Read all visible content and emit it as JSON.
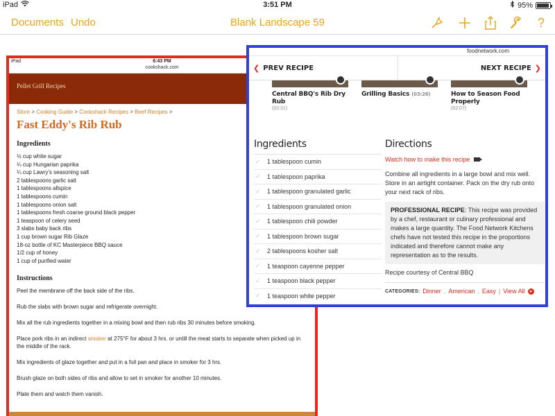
{
  "status_bar": {
    "device": "iPad",
    "time": "3:51 PM",
    "battery_percent_text": "95%",
    "battery_level": 0.95
  },
  "toolbar": {
    "documents_label": "Documents",
    "undo_label": "Undo",
    "title": "Blank Landscape 59",
    "icons": [
      "format-brush-icon",
      "plus-icon",
      "share-icon",
      "wrench-icon",
      "help-icon"
    ],
    "help_glyph": "?",
    "accent_color": "#e8a31a"
  },
  "left_screenshot": {
    "status": {
      "device": "iPad",
      "time": "6:43 PM"
    },
    "url": "cookshack.com",
    "header_title": "Pellet Grill Recipes",
    "breadcrumb": [
      "Store",
      "Cooking Guide",
      "Cookshack Recipes",
      "Beef Recipes"
    ],
    "title": "Fast Eddy's Rib Rub",
    "ingredients_heading": "Ingredients",
    "ingredients": [
      "½ cup white sugar",
      "¼ cup Hungarian paprika",
      "¼ cup Lawry's seasoning salt",
      "2 tablespoons garlic salt",
      "1 tablespoons allspice",
      "1 tablespoons cumin",
      "1 tablespoons onion salt",
      "1 tablespoons fresh coarse ground black pepper",
      "1 teaspoon of celery seed",
      "3 slabs baby back ribs",
      "1 cup brown sugar Rib Glaze",
      "18-oz bottle of KC Masterpiece BBQ sauce",
      "1/2 cup of honey",
      "1 cup of purified water"
    ],
    "instructions_heading": "Instructions",
    "instructions": [
      "Peel the membrane off the back side of the ribs.",
      "Rub the slabs with brown sugar and refrigerate overnight.",
      "Mix all the rub ingredients together in a mixing bowl and then rub ribs 30 minutes before smoking.",
      "Mix ingredients of glaze together and put in a foil pan and place in smoker for 3 hrs.",
      "Brush glaze on both sides of ribs and allow to set in smoker for another 10 minutes.",
      "Plate them and watch them vanish."
    ],
    "instruction_smoker": {
      "before": "Place pork ribs in an indirect ",
      "link": "smoker",
      "after": " at 275°F for about 3 hrs. or untill the meat starts to separate when picked up in the middle of the rack."
    },
    "frame_color": "#e32a22"
  },
  "right_screenshot": {
    "url": "foodnetwork.com",
    "prev_label": "PREV RECIPE",
    "next_label": "NEXT RECIPE",
    "videos": [
      {
        "title": "Central BBQ's Rib Dry Rub",
        "duration": "(02:31)"
      },
      {
        "title": "Grilling Basics",
        "duration": "(03:26)"
      },
      {
        "title": "How to Season Food Properly",
        "duration": "(02:07)"
      }
    ],
    "ingredients_heading": "Ingredients",
    "ingredients": [
      "1 tablespoon cumin",
      "1 tablespoon paprika",
      "1 tablespoon granulated garlic",
      "1 tablespoon granulated onion",
      "1 tablespoon chili powder",
      "1 tablespoon brown sugar",
      "2 tablespoons kosher salt",
      "1 teaspoon cayenne pepper",
      "1 teaspoon black pepper",
      "1 teaspoon white pepper"
    ],
    "directions_heading": "Directions",
    "watch_label": "Watch how to make this recipe",
    "directions_text": "Combine all ingredients in a large bowl and mix well. Store in an airtight container. Pack on the dry rub onto your next rack of ribs.",
    "pro_label": "PROFESSIONAL RECIPE",
    "pro_text": ": This recipe was provided by a chef, restaurant or culinary professional and makes a large quantity. The Food Network Kitchens chefs have not tested this recipe in the proportions indicated and therefore cannot make any representation as to the results.",
    "courtesy": "Recipe courtesy of Central BBQ",
    "categories_label": "CATEGORIES:",
    "categories": [
      "Dinner",
      "American",
      "Easy"
    ],
    "view_all_label": "View All",
    "frame_color": "#2f41d8"
  }
}
